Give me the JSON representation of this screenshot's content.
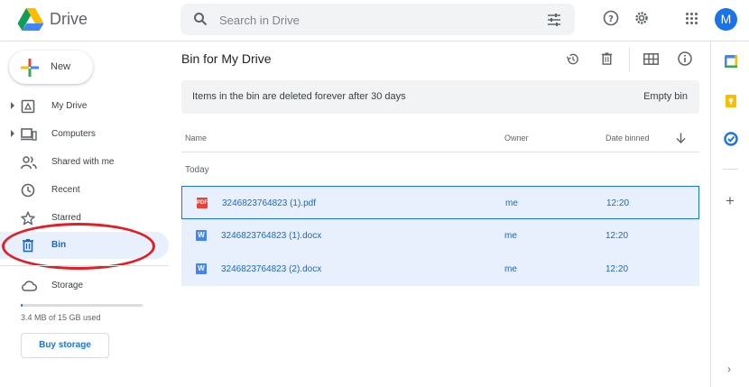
{
  "app": {
    "name": "Drive",
    "avatar_letter": "M"
  },
  "search": {
    "placeholder": "Search in Drive",
    "icon": "search-icon",
    "options_icon": "tune-icon"
  },
  "header_icons": [
    "help-icon",
    "settings-icon",
    "apps-grid-icon"
  ],
  "new_button": {
    "label": "New"
  },
  "sidebar": {
    "items": [
      {
        "label": "My Drive",
        "icon": "my-drive-icon",
        "expandable": true,
        "active": false
      },
      {
        "label": "Computers",
        "icon": "computer-icon",
        "expandable": true,
        "active": false
      },
      {
        "label": "Shared with me",
        "icon": "people-icon",
        "expandable": false,
        "active": false
      },
      {
        "label": "Recent",
        "icon": "clock-icon",
        "expandable": false,
        "active": false
      },
      {
        "label": "Starred",
        "icon": "star-icon",
        "expandable": false,
        "active": false
      },
      {
        "label": "Bin",
        "icon": "trash-icon",
        "expandable": false,
        "active": true
      }
    ],
    "storage": {
      "label": "Storage",
      "used_text": "3.4 MB of 15 GB used",
      "used_fraction": 0.0002,
      "buy_label": "Buy storage"
    }
  },
  "main": {
    "title": "Bin for My Drive",
    "banner": {
      "text": "Items in the bin are deleted forever after 30 days",
      "action": "Empty bin"
    },
    "columns": {
      "name": "Name",
      "owner": "Owner",
      "date": "Date binned"
    },
    "section_label": "Today",
    "files": [
      {
        "name": "3246823764823 (1).pdf",
        "type": "pdf",
        "badge": "PDF",
        "owner": "me",
        "date": "12:20"
      },
      {
        "name": "3246823764823 (1).docx",
        "type": "docx",
        "badge": "W",
        "owner": "me",
        "date": "12:20"
      },
      {
        "name": "3246823764823 (2).docx",
        "type": "docx",
        "badge": "W",
        "owner": "me",
        "date": "12:20"
      }
    ]
  },
  "colors": {
    "accent": "#1a73e8",
    "selected_bg": "#e8f0fe",
    "highlight_ellipse": "#e31e24",
    "pdf": "#ea4335",
    "docx": "#4285f4"
  }
}
